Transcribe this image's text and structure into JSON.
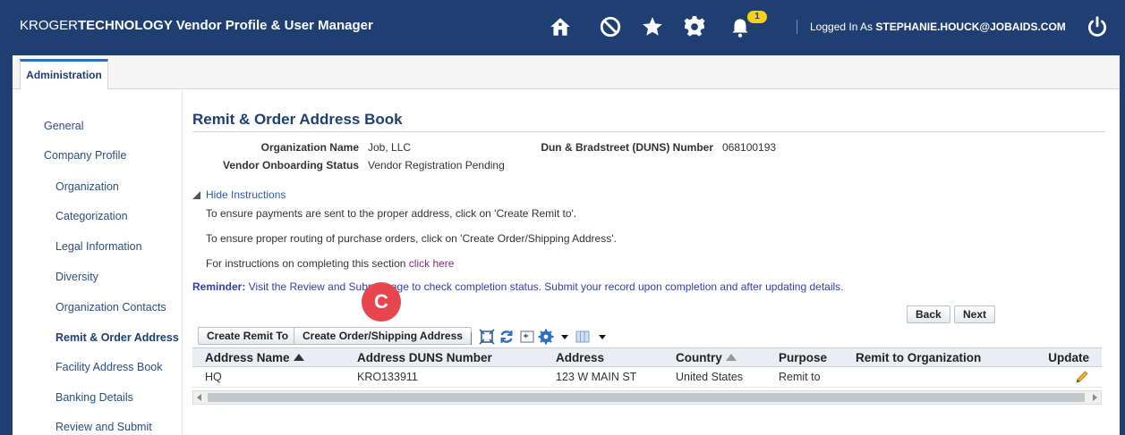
{
  "header": {
    "brand_prefix": "KROGER",
    "brand_tech": "TECHNOLOGY",
    "brand_app": " Vendor Profile & User Manager",
    "notification_count": "1",
    "logged_in_prefix": "Logged In As ",
    "user_email": "STEPHANIE.HOUCK@JOBAIDS.COM"
  },
  "tabs": [
    {
      "label": "Administration"
    }
  ],
  "sidebar": {
    "items": [
      {
        "label": "General"
      },
      {
        "label": "Company Profile"
      },
      {
        "label": "Organization"
      },
      {
        "label": "Categorization"
      },
      {
        "label": "Legal Information"
      },
      {
        "label": "Diversity"
      },
      {
        "label": "Organization Contacts"
      },
      {
        "label": "Remit & Order Address"
      },
      {
        "label": "Facility Address Book"
      },
      {
        "label": "Banking Details"
      },
      {
        "label": "Review and Submit"
      }
    ]
  },
  "main": {
    "title": "Remit & Order Address Book",
    "org_name_label": "Organization Name",
    "org_name_value": "Job, LLC",
    "duns_label": "Dun & Bradstreet (DUNS) Number",
    "duns_value": "068100193",
    "onboarding_label": "Vendor Onboarding Status",
    "onboarding_value": "Vendor Registration Pending",
    "hide_instructions": "Hide Instructions",
    "instr_1": "To ensure payments are sent to the proper address, click on 'Create Remit to'.",
    "instr_2": "To ensure proper routing of purchase orders, click on 'Create Order/Shipping Address'.",
    "instr_3_prefix": "For instructions on completing this section ",
    "instr_3_link": "click here",
    "reminder_label": "Reminder:",
    "reminder_text": " Visit the Review and Submit page to check completion status. Submit your record upon completion and after updating details.",
    "marker": "C",
    "back_label": "Back",
    "next_label": "Next",
    "create_remit_label": "Create Remit To",
    "create_order_label": "Create Order/Shipping Address"
  },
  "table": {
    "columns": [
      "Address Name",
      "Address DUNS Number",
      "Address",
      "Country",
      "Purpose",
      "Remit to Organization",
      "Update"
    ],
    "rows": [
      {
        "name": "HQ",
        "duns": "KRO133911",
        "address": "123 W MAIN ST",
        "country": "United States",
        "purpose": "Remit to",
        "remit_org": ""
      }
    ]
  },
  "colors": {
    "header_bg": "#1f3f72",
    "link": "#2f5aa3",
    "marker": "#e8464f",
    "badge": "#f2d21a"
  }
}
